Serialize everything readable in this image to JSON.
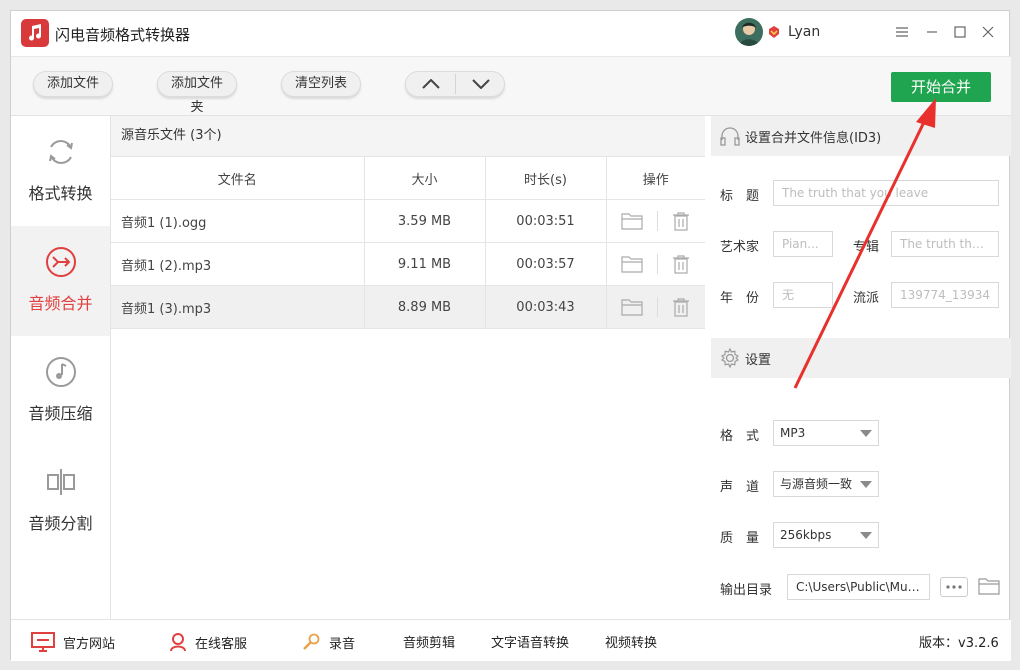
{
  "app": {
    "title": "闪电音频格式转换器"
  },
  "user": {
    "name": "Lyan"
  },
  "toolbar": {
    "add_file": "添加文件",
    "add_folder": "添加文件夹",
    "clear_list": "清空列表",
    "start_merge": "开始合并"
  },
  "sidebar": {
    "items": [
      {
        "label": "格式转换",
        "icon": "refresh-icon"
      },
      {
        "label": "音频合并",
        "icon": "merge-icon",
        "active": true
      },
      {
        "label": "音频压缩",
        "icon": "music-note-icon"
      },
      {
        "label": "音频分割",
        "icon": "split-icon"
      }
    ]
  },
  "filelist": {
    "header": "源音乐文件 (3个)",
    "columns": [
      "文件名",
      "大小",
      "时长(s)",
      "操作"
    ],
    "rows": [
      {
        "name": "音频1 (1).ogg",
        "size": "3.59 MB",
        "duration": "00:03:51"
      },
      {
        "name": "音频1 (2).mp3",
        "size": "9.11 MB",
        "duration": "00:03:57"
      },
      {
        "name": "音频1 (3).mp3",
        "size": "8.89 MB",
        "duration": "00:03:43"
      }
    ]
  },
  "id3": {
    "heading": "设置合并文件信息(ID3)",
    "title_label": "标　题",
    "title_placeholder": "The truth that you leave",
    "artist_label": "艺术家",
    "artist_placeholder": "Pian...",
    "album_label": "专辑",
    "album_placeholder": "The truth that...",
    "year_label": "年　份",
    "year_placeholder": "无",
    "genre_label": "流派",
    "genre_placeholder": "139774_13934"
  },
  "settings": {
    "heading": "设置",
    "format_label": "格　式",
    "format_value": "MP3",
    "channel_label": "声　道",
    "channel_value": "与源音频一致",
    "quality_label": "质　量",
    "quality_value": "256kbps",
    "output_label": "输出目录",
    "output_value": "C:\\Users\\Public\\Music\\"
  },
  "statusbar": {
    "website": "官方网站",
    "support": "在线客服",
    "record": "录音",
    "audio_edit": "音频剪辑",
    "tts": "文字语音转换",
    "video": "视频转换",
    "version": "版本：v3.2.6"
  },
  "colors": {
    "accent_red": "#e0403f",
    "start_green": "#1fa44f",
    "arrow_red": "#e8302d"
  }
}
